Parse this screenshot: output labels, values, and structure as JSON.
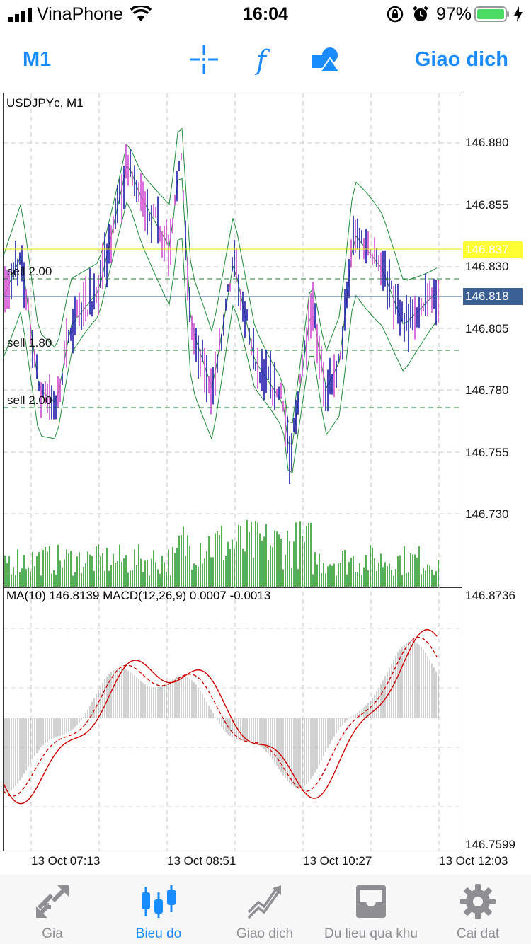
{
  "status_bar": {
    "carrier": "VinaPhone",
    "time": "16:04",
    "battery": "97%"
  },
  "toolbar": {
    "timeframe": "M1",
    "tools": [
      "crosshair-icon",
      "indicator-f-icon",
      "objects-icon"
    ],
    "trade_label": "Giao dich"
  },
  "chart": {
    "symbol_label": "USDJPYc, M1",
    "price_labels": [
      "146.880",
      "146.855",
      "146.830",
      "146.805",
      "146.780",
      "146.755",
      "146.730"
    ],
    "ask_price": "146.837",
    "bid_price": "146.818",
    "orders": [
      {
        "label": "sell 2.00"
      },
      {
        "label": "sell 1.80"
      },
      {
        "label": "sell 2.00"
      }
    ],
    "indicator_label": "MA(10) 146.8139 MACD(12,26,9) 0.0007 -0.0013",
    "indicator_scale_top": "146.8736",
    "indicator_scale_bottom": "146.7599",
    "time_labels": [
      "13 Oct 07:13",
      "13 Oct 08:51",
      "13 Oct 10:27",
      "13 Oct 12:03"
    ],
    "colors": {
      "bull": "#1a1aa6",
      "bear": "#d24fd2",
      "bands": "#1e8a3a",
      "volume": "#2e9b2e",
      "ask_line": "#e6e600",
      "bid_box": "#3c5f93",
      "macd_line": "#cc0000",
      "histogram": "#b8b8b8"
    }
  },
  "tab_bar": {
    "active": 1,
    "tabs": [
      {
        "label": "Gia",
        "icon": "quotes-arrows-icon"
      },
      {
        "label": "Bieu do",
        "icon": "candlestick-icon"
      },
      {
        "label": "Giao dich",
        "icon": "trade-trend-icon"
      },
      {
        "label": "Du lieu qua khu",
        "icon": "history-tray-icon"
      },
      {
        "label": "Cai dat",
        "icon": "gear-icon"
      }
    ]
  }
}
